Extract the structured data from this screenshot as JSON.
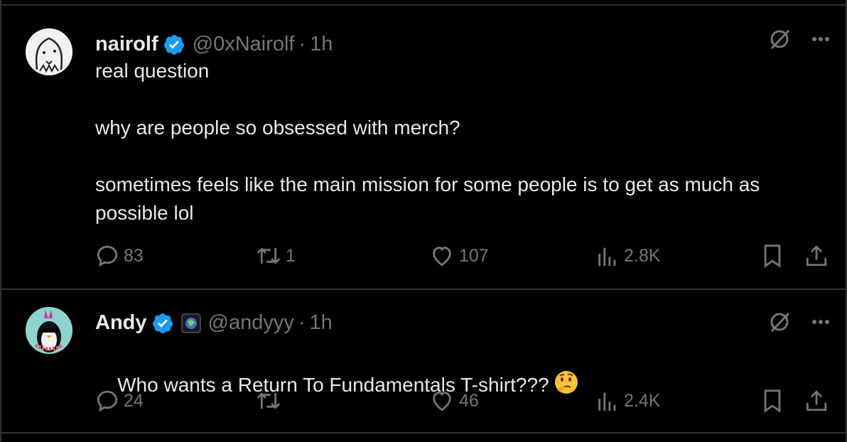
{
  "colors": {
    "background": "#000000",
    "text": "#e7e9ea",
    "muted": "#71767b",
    "verified": "#1d9bf0",
    "divider": "#2f3336"
  },
  "tweets": [
    {
      "name": "nairolf",
      "handle": "@0xNairolf",
      "dot": "·",
      "time": "1h",
      "text": "real question\n\nwhy are people so obsessed with merch?\n\nsometimes feels like the main mission for some people is to get as much as possible lol",
      "replies": "83",
      "reposts": "1",
      "likes": "107",
      "views": "2.8K",
      "icons": {
        "avatar": "ghost-avatar-icon",
        "verified": "verified-badge-icon"
      }
    },
    {
      "name": "Andy",
      "handle": "@andyyy",
      "dot": "·",
      "time": "1h",
      "text": "Who wants a Return To Fundamentals T-shirt???",
      "emoji": "thinking-face-icon",
      "replies": "24",
      "reposts": "",
      "likes": "46",
      "views": "2.4K",
      "icons": {
        "avatar": "penguin-avatar-icon",
        "verified": "verified-badge-icon",
        "affiliate": "globe-badge-icon"
      }
    }
  ]
}
